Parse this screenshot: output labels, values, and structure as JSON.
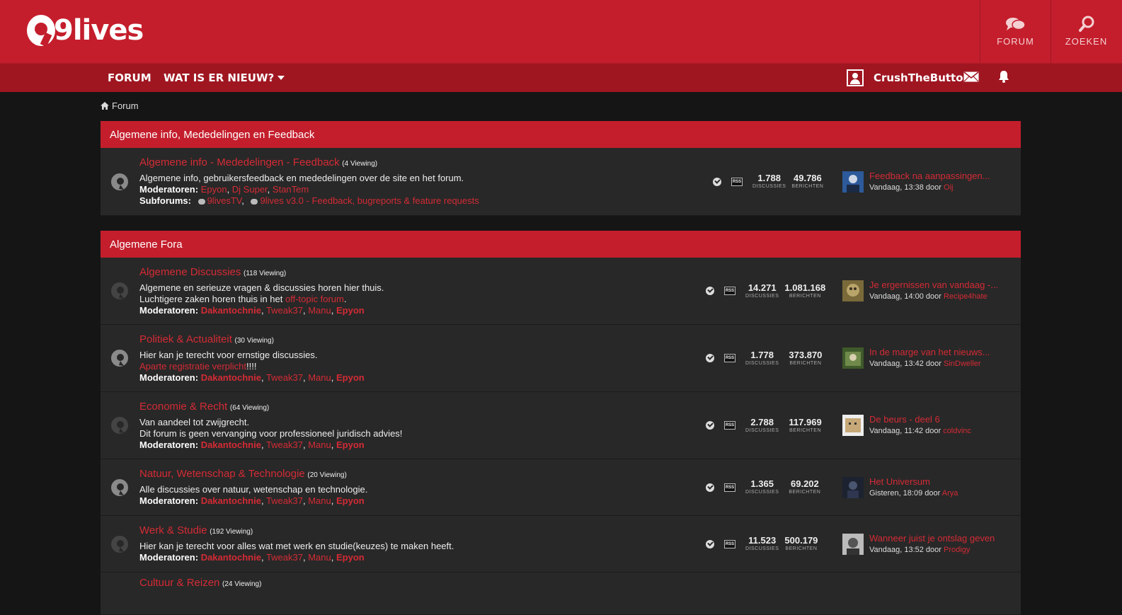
{
  "header": {
    "logo_text": "9lives",
    "forum_btn": "FORUM",
    "zoeken_btn": "ZOEKEN"
  },
  "nav": {
    "forum": "FORUM",
    "whats_new": "WAT IS ER NIEUW?",
    "username": "CrushTheButton"
  },
  "breadcrumb": {
    "label": "Forum"
  },
  "categories": [
    {
      "title": "Algemene info, Mededelingen en Feedback",
      "nodes": [
        {
          "title": "Algemene info - Mededelingen - Feedback",
          "viewing": "(4 Viewing)",
          "desc": "Algemene info, gebruikersfeedback en mededelingen over de site en het forum.",
          "mod_label": "Moderatoren:",
          "mods": [
            "Epyon",
            "Dj Super",
            "StanTem"
          ],
          "sub_label": "Subforums:",
          "subs": [
            "9livesTV",
            "9lives v3.0 - Feedback, bugreports & feature requests"
          ],
          "discussions": "1.788",
          "posts": "49.786",
          "last_title": "Feedback na aanpassingen...",
          "last_meta": "Vandaag, 13:38 door",
          "last_user": "Oij"
        }
      ]
    },
    {
      "title": "Algemene Fora",
      "nodes": [
        {
          "title": "Algemene Discussies",
          "viewing": "(118 Viewing)",
          "desc": "Algemene en serieuze vragen & discussies horen hier thuis.",
          "desc2_pre": "Luchtigere zaken horen thuis in het",
          "desc2_link": "off-topic forum",
          "desc2_post": ".",
          "mod_label": "Moderatoren:",
          "mods": [
            "Dakantochnie",
            "Tweak37",
            "Manu",
            "Epyon"
          ],
          "discussions": "14.271",
          "posts": "1.081.168",
          "last_title": "Je ergernissen van vandaag -...",
          "last_meta": "Vandaag, 14:00 door",
          "last_user": "Recipe4hate"
        },
        {
          "title": "Politiek & Actualiteit",
          "viewing": "(30 Viewing)",
          "desc": "Hier kan je terecht voor ernstige discussies.",
          "desc2_link": "Aparte registratie verplicht",
          "desc2_post": "!!!!",
          "mod_label": "Moderatoren:",
          "mods": [
            "Dakantochnie",
            "Tweak37",
            "Manu",
            "Epyon"
          ],
          "discussions": "1.778",
          "posts": "373.870",
          "last_title": "In de marge van het nieuws...",
          "last_meta": "Vandaag, 13:42 door",
          "last_user": "SinDweller"
        },
        {
          "title": "Economie & Recht",
          "viewing": "(64 Viewing)",
          "desc": "Van aandeel tot zwijgrecht.",
          "desc2_plain": "Dit forum is geen vervanging voor professioneel juridisch advies!",
          "mod_label": "Moderatoren:",
          "mods": [
            "Dakantochnie",
            "Tweak37",
            "Manu",
            "Epyon"
          ],
          "discussions": "2.788",
          "posts": "117.969",
          "last_title": "De beurs - deel 6",
          "last_meta": "Vandaag, 11:42 door",
          "last_user": "coldvinc"
        },
        {
          "title": "Natuur, Wetenschap & Technologie",
          "viewing": "(20 Viewing)",
          "desc": "Alle discussies over natuur, wetenschap en technologie.",
          "mod_label": "Moderatoren:",
          "mods": [
            "Dakantochnie",
            "Tweak37",
            "Manu",
            "Epyon"
          ],
          "discussions": "1.365",
          "posts": "69.202",
          "last_title": "Het Universum",
          "last_meta": "Gisteren, 18:09 door",
          "last_user": "Arya"
        },
        {
          "title": "Werk & Studie",
          "viewing": "(192 Viewing)",
          "desc": "Hier kan je terecht voor alles wat met werk en studie(keuzes) te maken heeft.",
          "mod_label": "Moderatoren:",
          "mods": [
            "Dakantochnie",
            "Tweak37",
            "Manu",
            "Epyon"
          ],
          "discussions": "11.523",
          "posts": "500.179",
          "last_title": "Wanneer juist je ontslag geven",
          "last_meta": "Vandaag, 13:52 door",
          "last_user": "Prodigy"
        },
        {
          "title": "Cultuur & Reizen",
          "viewing": "(24 Viewing)"
        }
      ]
    }
  ],
  "stat_labels": {
    "discussions": "DISCUSSIES",
    "posts": "BERICHTEN"
  },
  "rss_label": "RSS"
}
